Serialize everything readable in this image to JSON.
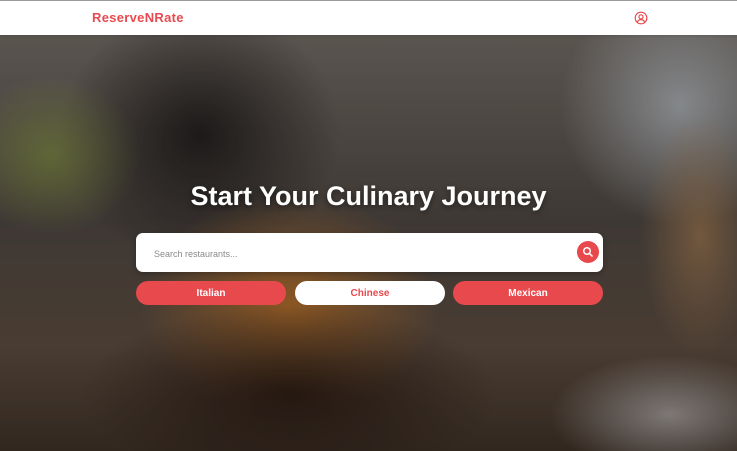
{
  "header": {
    "brand": "ReserveNRate",
    "profile_icon": "user-circle-icon"
  },
  "hero": {
    "title": "Start Your Culinary Journey",
    "search": {
      "placeholder": "Search restaurants...",
      "value": "",
      "button_icon": "search-icon"
    },
    "categories": [
      {
        "label": "Italian",
        "style": "filled"
      },
      {
        "label": "Chinese",
        "style": "outline-white"
      },
      {
        "label": "Mexican",
        "style": "filled"
      }
    ]
  },
  "colors": {
    "accent": "#e8494d",
    "brand_text": "#e84a4f",
    "header_bg": "#ffffff"
  }
}
